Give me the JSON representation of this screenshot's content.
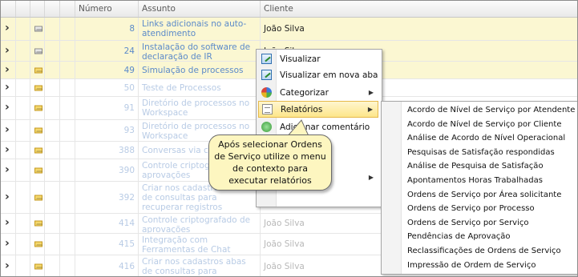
{
  "grid": {
    "columns": {
      "numero": "Número",
      "assunto": "Assunto",
      "cliente": "Cliente"
    },
    "rows": [
      {
        "numero": "8",
        "assunto": "Links adicionais no auto-atendimento",
        "cliente": "João Silva",
        "icon": "envelope-open-icon"
      },
      {
        "numero": "24",
        "assunto": "Instalação do software de declaração de IR",
        "cliente": "João Silva",
        "icon": "envelope-open-icon"
      },
      {
        "numero": "49",
        "assunto": "Simulação de processos",
        "cliente": "",
        "icon": "envelope-closed-icon"
      },
      {
        "numero": "50",
        "assunto": "Teste de Processos",
        "cliente": "",
        "icon": "envelope-closed-icon"
      },
      {
        "numero": "91",
        "assunto": "Diretório de processos no Workspace",
        "cliente": "",
        "icon": "envelope-closed-icon"
      },
      {
        "numero": "93",
        "assunto": "Diretório de processos no Workspace",
        "cliente": "",
        "icon": "envelope-closed-icon"
      },
      {
        "numero": "388",
        "assunto": "Conversas via chat",
        "cliente": "",
        "icon": "envelope-closed-icon"
      },
      {
        "numero": "390",
        "assunto": "Controle criptografado de aprovações",
        "cliente": "",
        "icon": "envelope-closed-icon"
      },
      {
        "numero": "392",
        "assunto": "Criar nos cadastros abas de consultas para recuperar registros relacionados",
        "cliente": "",
        "icon": "envelope-closed-icon"
      },
      {
        "numero": "414",
        "assunto": "Controle criptografado de aprovações",
        "cliente": "João Silva",
        "icon": "envelope-closed-icon"
      },
      {
        "numero": "415",
        "assunto": "Integração com Ferramentas de Chat",
        "cliente": "João Silva",
        "icon": "envelope-closed-icon"
      },
      {
        "numero": "416",
        "assunto": "Criar nos cadastros abas de consultas para recuperar",
        "cliente": "João Silva",
        "icon": "envelope-closed-icon"
      }
    ]
  },
  "context_menu": {
    "items": [
      {
        "label": "Visualizar",
        "icon": "view-icon"
      },
      {
        "label": "Visualizar em nova aba",
        "icon": "view-new-tab-icon"
      },
      {
        "label": "Categorizar",
        "icon": "categorize-icon",
        "submenu": true
      },
      {
        "label": "Relatórios",
        "icon": "report-icon",
        "submenu": true,
        "selected": true
      },
      {
        "label": "Adicionar comentário",
        "icon": "add-comment-icon"
      },
      {
        "label": "",
        "icon": "",
        "submenu": false
      },
      {
        "label": "",
        "icon": "",
        "submenu": true
      }
    ]
  },
  "reports_submenu": {
    "items": [
      "Acordo de Nível de Serviço por Atendente",
      "Acordo de Nível de Serviço por Cliente",
      "Análise de Acordo de Nível Operacional",
      "Pesquisas de Satisfação respondidas",
      "Análise de Pesquisa de Satisfação",
      "Apontamentos Horas Trabalhadas",
      "Ordens de Serviço por Área solicitante",
      "Ordens de Serviço por Processo",
      "Ordens de Serviço por Serviço",
      "Pendências de Aprovação",
      "Reclassificações de Ordens de Serviço",
      "Impressão de Ordem de Serviço"
    ]
  },
  "callout": {
    "text": "Após selecionar Ordens de Serviço utilize o menu de contexto para executar relatórios"
  }
}
